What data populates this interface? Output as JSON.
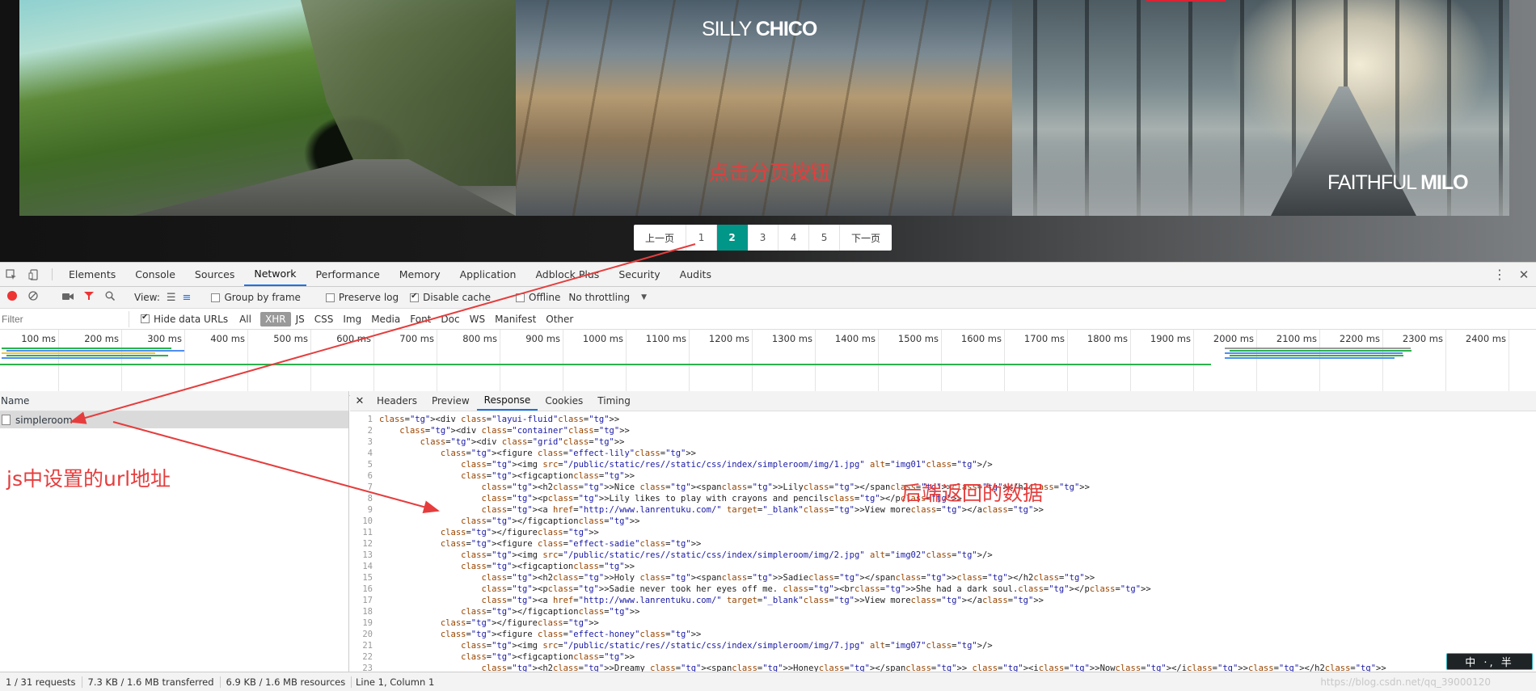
{
  "gallery": {
    "photo2_title_a": "SILLY",
    "photo2_title_b": "CHICO",
    "photo3_title_a": "FAITHFUL",
    "photo3_title_b": "MILO",
    "annotation": "点击分页按钮"
  },
  "pager": {
    "prev": "上一页",
    "pages": [
      "1",
      "2",
      "3",
      "4",
      "5"
    ],
    "current": "2",
    "next": "下一页",
    "current_color": "#009688"
  },
  "devtools": {
    "tabs": [
      "Elements",
      "Console",
      "Sources",
      "Network",
      "Performance",
      "Memory",
      "Application",
      "Adblock Plus",
      "Security",
      "Audits"
    ],
    "active_tab": "Network",
    "icons": {
      "inspect": "select-element-icon",
      "device": "device-toggle-icon",
      "menu": "more-vert-icon",
      "close": "close-icon"
    }
  },
  "network_toolbar": {
    "view_label": "View:",
    "group_by_frame": "Group by frame",
    "preserve_log": "Preserve log",
    "disable_cache": "Disable cache",
    "offline": "Offline",
    "throttling": "No throttling",
    "disable_cache_checked": true
  },
  "filter_bar": {
    "placeholder": "Filter",
    "hide_data_urls": "Hide data URLs",
    "types": [
      "All",
      "XHR",
      "JS",
      "CSS",
      "Img",
      "Media",
      "Font",
      "Doc",
      "WS",
      "Manifest",
      "Other"
    ],
    "active_type": "XHR"
  },
  "timeline": {
    "ticks": [
      "100 ms",
      "200 ms",
      "300 ms",
      "400 ms",
      "500 ms",
      "600 ms",
      "700 ms",
      "800 ms",
      "900 ms",
      "1000 ms",
      "1100 ms",
      "1200 ms",
      "1300 ms",
      "1400 ms",
      "1500 ms",
      "1600 ms",
      "1700 ms",
      "1800 ms",
      "1900 ms",
      "2000 ms",
      "2100 ms",
      "2200 ms",
      "2300 ms",
      "2400 ms",
      "2"
    ]
  },
  "requests": {
    "header": "Name",
    "items": [
      {
        "name": "simpleroom"
      }
    ],
    "annotation": "js中设置的url地址"
  },
  "response": {
    "tabs": [
      "Headers",
      "Preview",
      "Response",
      "Cookies",
      "Timing"
    ],
    "active_tab": "Response",
    "lines": [
      "<div class=\"layui-fluid\">",
      "    <div class=\"container\">",
      "        <div class=\"grid\">",
      "            <figure class=\"effect-lily\">",
      "                <img src=\"/public/static/res//static/css/index/simpleroom/img/1.jpg\" alt=\"img01\"/>",
      "                <figcaption>",
      "                    <h2>Nice <span>Lily</span></h2>",
      "                    <p>Lily likes to play with crayons and pencils</p>",
      "                    <a href=\"http://www.lanrentuku.com/\" target=\"_blank\">View more</a>",
      "                </figcaption>",
      "            </figure>",
      "            <figure class=\"effect-sadie\">",
      "                <img src=\"/public/static/res//static/css/index/simpleroom/img/2.jpg\" alt=\"img02\"/>",
      "                <figcaption>",
      "                    <h2>Holy <span>Sadie</span></h2>",
      "                    <p>Sadie never took her eyes off me. <br>She had a dark soul.</p>",
      "                    <a href=\"http://www.lanrentuku.com/\" target=\"_blank\">View more</a>",
      "                </figcaption>",
      "            </figure>",
      "            <figure class=\"effect-honey\">",
      "                <img src=\"/public/static/res//static/css/index/simpleroom/img/7.jpg\" alt=\"img07\"/>",
      "                <figcaption>",
      "                    <h2>Dreamy <span>Honey</span> <i>Now</i></h2>"
    ],
    "annotation": "后端返回的数据"
  },
  "status_bar": {
    "requests": "1 / 31 requests",
    "transferred": "7.3 KB / 1.6 MB transferred",
    "resources": "6.9 KB / 1.6 MB resources",
    "cursor": "Line 1, Column 1",
    "watermark": "https://blog.csdn.net/qq_39000120"
  },
  "ime": {
    "text": "中 ·, 半"
  },
  "colors": {
    "annotation": "#e53d3d",
    "accent": "#1a73e8",
    "record": "#ee3333"
  }
}
